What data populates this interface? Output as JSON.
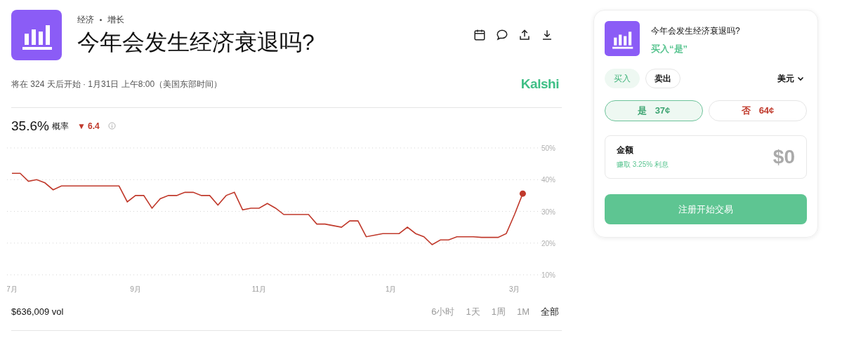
{
  "market": {
    "breadcrumb": [
      "经济",
      "增长"
    ],
    "title": "今年会发生经济衰退吗?",
    "schedule": "将在 324 天后开始 · 1月31日 上午8:00（美国东部时间）",
    "brand": "Kalshi"
  },
  "stats": {
    "probability": "35.6%",
    "probability_label": "概率",
    "change": "▼ 6.4"
  },
  "chart": {
    "chart_data": {
      "type": "line",
      "categories": [
        "7月",
        null,
        null,
        null,
        null,
        null,
        null,
        null,
        null,
        null,
        null,
        null,
        null,
        null,
        null,
        "9月",
        null,
        null,
        null,
        null,
        null,
        null,
        null,
        null,
        null,
        null,
        null,
        null,
        null,
        null,
        "11月",
        null,
        null,
        null,
        null,
        null,
        null,
        null,
        null,
        null,
        null,
        null,
        null,
        null,
        null,
        null,
        "1月",
        null,
        null,
        null,
        null,
        null,
        null,
        null,
        null,
        null,
        null,
        null,
        null,
        null,
        null,
        "3月",
        null
      ],
      "series": [
        {
          "color": "#c0392b",
          "values": [
            42,
            42,
            39.5,
            40,
            39,
            36.8,
            38,
            38,
            38,
            38,
            38,
            38,
            38,
            38,
            33,
            35,
            35,
            31,
            34,
            35,
            35,
            36,
            36,
            35,
            35,
            32,
            35,
            36,
            30.5,
            31,
            31,
            32.5,
            31,
            29,
            29,
            29,
            29,
            26,
            26,
            25.5,
            25,
            27,
            27,
            22,
            22.5,
            23,
            23,
            23,
            25,
            23,
            22,
            19.5,
            21,
            21,
            22,
            22,
            22,
            21.8,
            21.8,
            21.8,
            23,
            29,
            35.6
          ]
        }
      ],
      "ylim": [
        10,
        50
      ],
      "grid": true,
      "yticks": [
        {
          "value": 10,
          "label": "10%"
        },
        {
          "value": 20,
          "label": "20%"
        },
        {
          "value": 30,
          "label": "30%"
        },
        {
          "value": 40,
          "label": "40%"
        },
        {
          "value": 50,
          "label": "50%"
        }
      ]
    }
  },
  "volume": "$636,009 vol",
  "ranges": [
    {
      "label": "6小时",
      "selected": false
    },
    {
      "label": "1天",
      "selected": false
    },
    {
      "label": "1周",
      "selected": false
    },
    {
      "label": "1M",
      "selected": false
    },
    {
      "label": "全部",
      "selected": true
    }
  ],
  "order": {
    "title": "今年会发生经济衰退吗?",
    "subtitle": "买入“是”",
    "sides": [
      {
        "label": "买入",
        "selected": true
      },
      {
        "label": "卖出",
        "selected": false
      }
    ],
    "currency": "美元",
    "outcomes": [
      {
        "kind": "yes",
        "label": "是",
        "price": "37¢",
        "selected": true
      },
      {
        "kind": "no",
        "label": "否",
        "price": "64¢",
        "selected": false
      }
    ],
    "amount_label": "金额",
    "interest": "赚取 3.25% 利息",
    "amount": "$0",
    "submit": "注册开始交易"
  }
}
